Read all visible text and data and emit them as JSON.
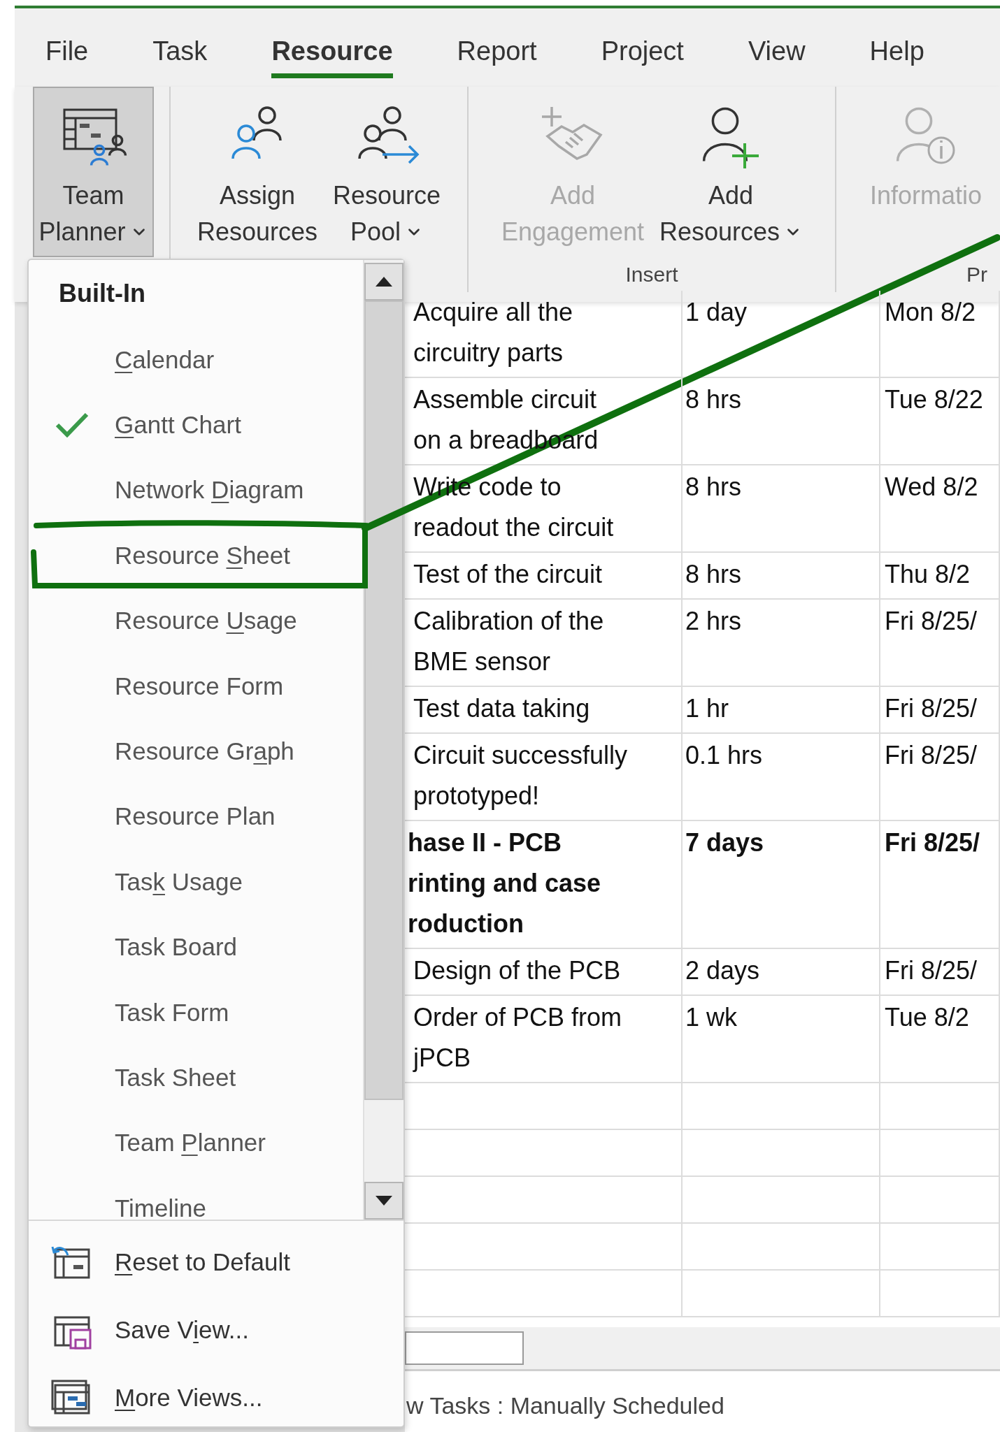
{
  "menu_tabs": [
    {
      "label": "File",
      "selected": false
    },
    {
      "label": "Task",
      "selected": false
    },
    {
      "label": "Resource",
      "selected": true
    },
    {
      "label": "Report",
      "selected": false
    },
    {
      "label": "Project",
      "selected": false
    },
    {
      "label": "View",
      "selected": false
    },
    {
      "label": "Help",
      "selected": false
    }
  ],
  "ribbon": {
    "groups": [
      {
        "buttons": [
          {
            "kind": "team_planner",
            "lines": [
              "Team",
              "Planner"
            ],
            "dropdown": true,
            "pressed": true,
            "disabled": false
          }
        ]
      },
      {
        "buttons": [
          {
            "kind": "assign_resources",
            "lines": [
              "Assign",
              "Resources"
            ],
            "dropdown": false,
            "pressed": false,
            "disabled": false
          },
          {
            "kind": "resource_pool",
            "lines": [
              "Resource",
              "Pool"
            ],
            "dropdown": true,
            "pressed": false,
            "disabled": false
          }
        ]
      },
      {
        "label": "Insert",
        "buttons": [
          {
            "kind": "add_engagement",
            "lines": [
              "Add",
              "Engagement"
            ],
            "dropdown": false,
            "pressed": false,
            "disabled": true
          },
          {
            "kind": "add_resources",
            "lines": [
              "Add",
              "Resources"
            ],
            "dropdown": true,
            "pressed": false,
            "disabled": false
          }
        ]
      },
      {
        "label": "Pr",
        "buttons": [
          {
            "kind": "information",
            "lines": [
              "Informatio"
            ],
            "dropdown": false,
            "pressed": false,
            "disabled": true
          }
        ]
      }
    ]
  },
  "view_menu": {
    "heading": "Built-In",
    "items": [
      {
        "access_key": "C",
        "text_after": "alendar",
        "checked": false
      },
      {
        "access_key": "G",
        "text_after": "antt Chart",
        "checked": true
      },
      {
        "text_before": "Network ",
        "access_key": "D",
        "text_after": "iagram",
        "checked": false
      },
      {
        "text_before": "Resource ",
        "access_key": "S",
        "text_after": "heet",
        "checked": false
      },
      {
        "text_before": "Resource ",
        "access_key": "U",
        "text_after": "sage",
        "checked": false
      },
      {
        "text_before": "Resource Form",
        "checked": false
      },
      {
        "text_before": "Resource Gr",
        "access_key": "a",
        "text_after": "ph",
        "checked": false
      },
      {
        "text_before": "Resource Plan",
        "checked": false
      },
      {
        "text_before": "Tas",
        "access_key": "k",
        "text_after": " Usage",
        "checked": false
      },
      {
        "text_before": "Task Board",
        "checked": false
      },
      {
        "text_before": "Task Form",
        "checked": false
      },
      {
        "text_before": "Task Sheet",
        "checked": false
      },
      {
        "text_before": "Team ",
        "access_key": "P",
        "text_after": "lanner",
        "checked": false
      },
      {
        "text_before": "Timeline",
        "checked": false
      }
    ],
    "actions": [
      {
        "kind": "reset",
        "access_key": "R",
        "text_after": "eset to Default"
      },
      {
        "kind": "save",
        "text_before": "Save V",
        "access_key": "i",
        "text_after": "ew..."
      },
      {
        "kind": "more",
        "access_key": "M",
        "text_after": "ore Views..."
      }
    ]
  },
  "table": {
    "rows": [
      {
        "name": "Acquire all the\ncircuitry parts",
        "duration": "1 day",
        "start": "Mon 8/2",
        "summary": false
      },
      {
        "name": "Assemble circuit\non a breadboard",
        "duration": "8 hrs",
        "start": "Tue 8/22",
        "summary": false
      },
      {
        "name": "Write code to\nreadout the circuit",
        "duration": "8 hrs",
        "start": "Wed 8/2",
        "summary": false
      },
      {
        "name": "Test of the circuit",
        "duration": "8 hrs",
        "start": "Thu 8/2",
        "summary": false
      },
      {
        "name": "Calibration of the\nBME sensor",
        "duration": "2 hrs",
        "start": "Fri 8/25/",
        "summary": false
      },
      {
        "name": "Test data taking",
        "duration": "1 hr",
        "start": "Fri 8/25/",
        "summary": false
      },
      {
        "name": "Circuit successfully\nprototyped!",
        "duration": "0.1 hrs",
        "start": "Fri 8/25/",
        "summary": false
      },
      {
        "name": "hase II - PCB\nrinting and case\nroduction",
        "duration": "7 days",
        "start": "Fri 8/25/",
        "summary": true
      },
      {
        "name": "Design of the PCB",
        "duration": "2 days",
        "start": "Fri 8/25/",
        "summary": false
      },
      {
        "name": "Order of PCB from\njPCB",
        "duration": "1 wk",
        "start": "Tue 8/2",
        "summary": false
      }
    ]
  },
  "status_bar": {
    "text": "w Tasks : Manually Scheduled"
  }
}
